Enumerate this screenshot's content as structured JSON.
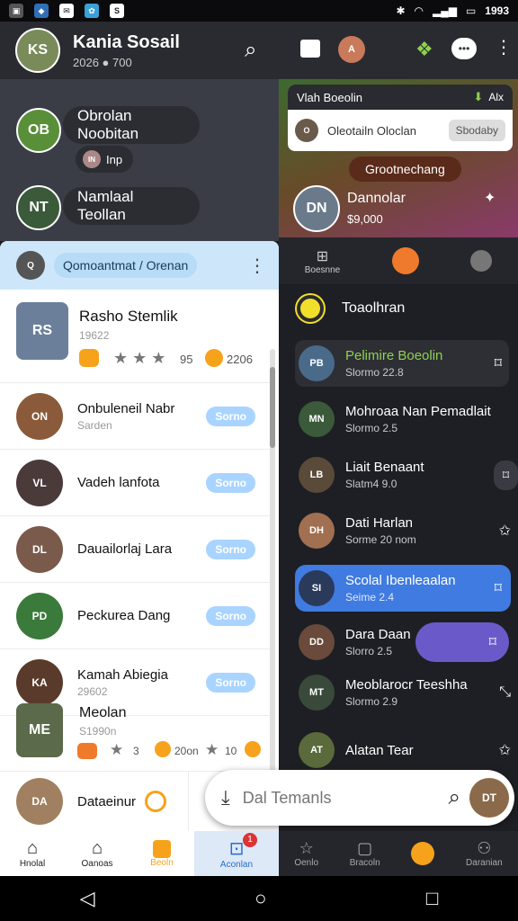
{
  "status_bar": {
    "time": "1993"
  },
  "header": {
    "name": "Kania Sosail",
    "stats": "2026 ● 700",
    "avatar": "KS"
  },
  "chat_bubbles": [
    {
      "text": "Obrolan Noobitan",
      "avatar": "OB"
    },
    {
      "text": "Inp",
      "avatar": "IN"
    },
    {
      "text": "Namlaal Teollan",
      "avatar": "NT"
    }
  ],
  "card": {
    "title": "Qomoantmat / Orenan",
    "featured": {
      "name": "Rasho Stemlik",
      "sub": "19622",
      "score": "95",
      "count": "2206"
    },
    "rows": [
      {
        "name": "Onbuleneil Nabr",
        "sub": "Sarden",
        "button": "Sorno"
      },
      {
        "name": "Vadeh lanfota",
        "sub": "",
        "button": "Sorno"
      },
      {
        "name": "Dauailorlaj Lara",
        "sub": "",
        "button": "Sorno"
      },
      {
        "name": "Peckurea Dang",
        "sub": "",
        "button": "Sorno"
      },
      {
        "name": "Kamah Abiegia",
        "sub": "29602",
        "button": "Sorno"
      }
    ],
    "featured2": {
      "name": "Meolan",
      "sub": "S1990n",
      "rating": "3",
      "count": "20on",
      "rating2": "10"
    },
    "last": {
      "name": "Dataeinur"
    }
  },
  "right": {
    "notice": {
      "title": "Vlah Boeolin",
      "action": "Alx",
      "contact": "Oleotailn Oloclan",
      "button": "Sbodaby"
    },
    "banner": "Grootnechang",
    "profile": {
      "name": "Dannolar",
      "value": "$9,000"
    },
    "tabs": [
      "Boesnne",
      "",
      ""
    ],
    "section": "Toaolhran",
    "items": [
      {
        "title": "Pelimire Boeolin",
        "sub": "Slormo 22.8"
      },
      {
        "title": "Mohroaa Nan Pemadlait",
        "sub": "Slormo 2.5"
      },
      {
        "title": "Liait Benaant",
        "sub": "Slatm4 9.0"
      },
      {
        "title": "Dati Harlan",
        "sub": "Sorme 20 nom"
      },
      {
        "title": "Scolal Ibenleaalan",
        "sub": "Seime 2.4"
      },
      {
        "title": "Dara Daan",
        "sub": "Slorro 2.5"
      },
      {
        "title": "Meoblarocr Teeshha",
        "sub": "Slormo 2.9"
      },
      {
        "title": "Alatan Tear",
        "sub": ""
      }
    ]
  },
  "search": {
    "placeholder": "Dal Temanls"
  },
  "nav": [
    {
      "label": "Hnolal"
    },
    {
      "label": "Oanoas"
    },
    {
      "label": "Beoln"
    },
    {
      "label": "Aconlan",
      "badge": "1"
    },
    {
      "label": "Oenlo"
    },
    {
      "label": "Bracoln"
    },
    {
      "label": ""
    },
    {
      "label": "Daranian"
    }
  ],
  "colors": {
    "accent": "#f7a21b",
    "blue": "#3f7be0",
    "purple": "#6a5ac9",
    "green": "#8fd14f",
    "pill": "#a9d4ff"
  }
}
